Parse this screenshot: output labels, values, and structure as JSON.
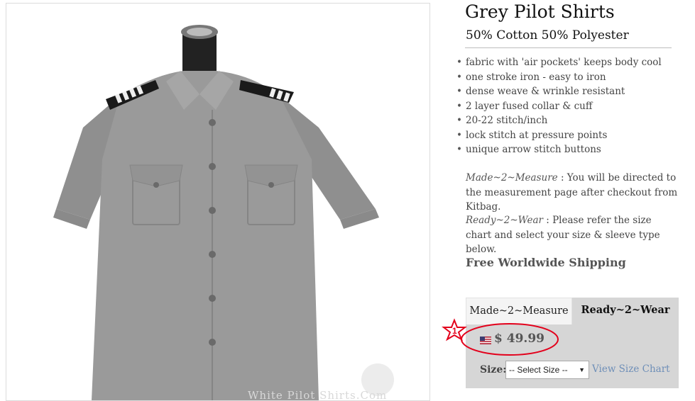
{
  "product": {
    "title": "Grey Pilot Shirts",
    "subtitle": "50% Cotton 50% Polyester",
    "features": [
      "fabric with 'air pockets' keeps body cool",
      "one stroke iron - easy to iron",
      "dense weave & wrinkle resistant",
      "2 layer fused collar & cuff",
      "20-22 stitch/inch",
      "lock stitch at pressure points",
      "unique arrow stitch buttons"
    ],
    "made_desc": {
      "label": "Made~2~Measure",
      "text": " : You will be directed to the measurement page after checkout from Kitbag."
    },
    "ready_desc": {
      "label": "Ready~2~Wear",
      "text": " : Please refer the size chart and select your size & sleeve type below."
    },
    "shipping": "Free Worldwide Shipping"
  },
  "tabs": [
    {
      "label": "Made~2~Measure",
      "active": false
    },
    {
      "label": "Ready~2~Wear",
      "active": true
    }
  ],
  "price": "$ 49.99",
  "size": {
    "label": "Size:",
    "selected": "-- Select Size --",
    "chart_link": "View Size Chart"
  },
  "image": {
    "watermark": "White Pilot Shirts.Com"
  },
  "annotation": {
    "marker": "1"
  },
  "colors": {
    "shirt": "#9a9a9a",
    "panel": "#d6d6d6",
    "annotation": "#e3001b",
    "link": "#6f8fb8"
  },
  "icons": {
    "flag": "us-flag-icon",
    "dropdown": "chevron-down-icon"
  }
}
